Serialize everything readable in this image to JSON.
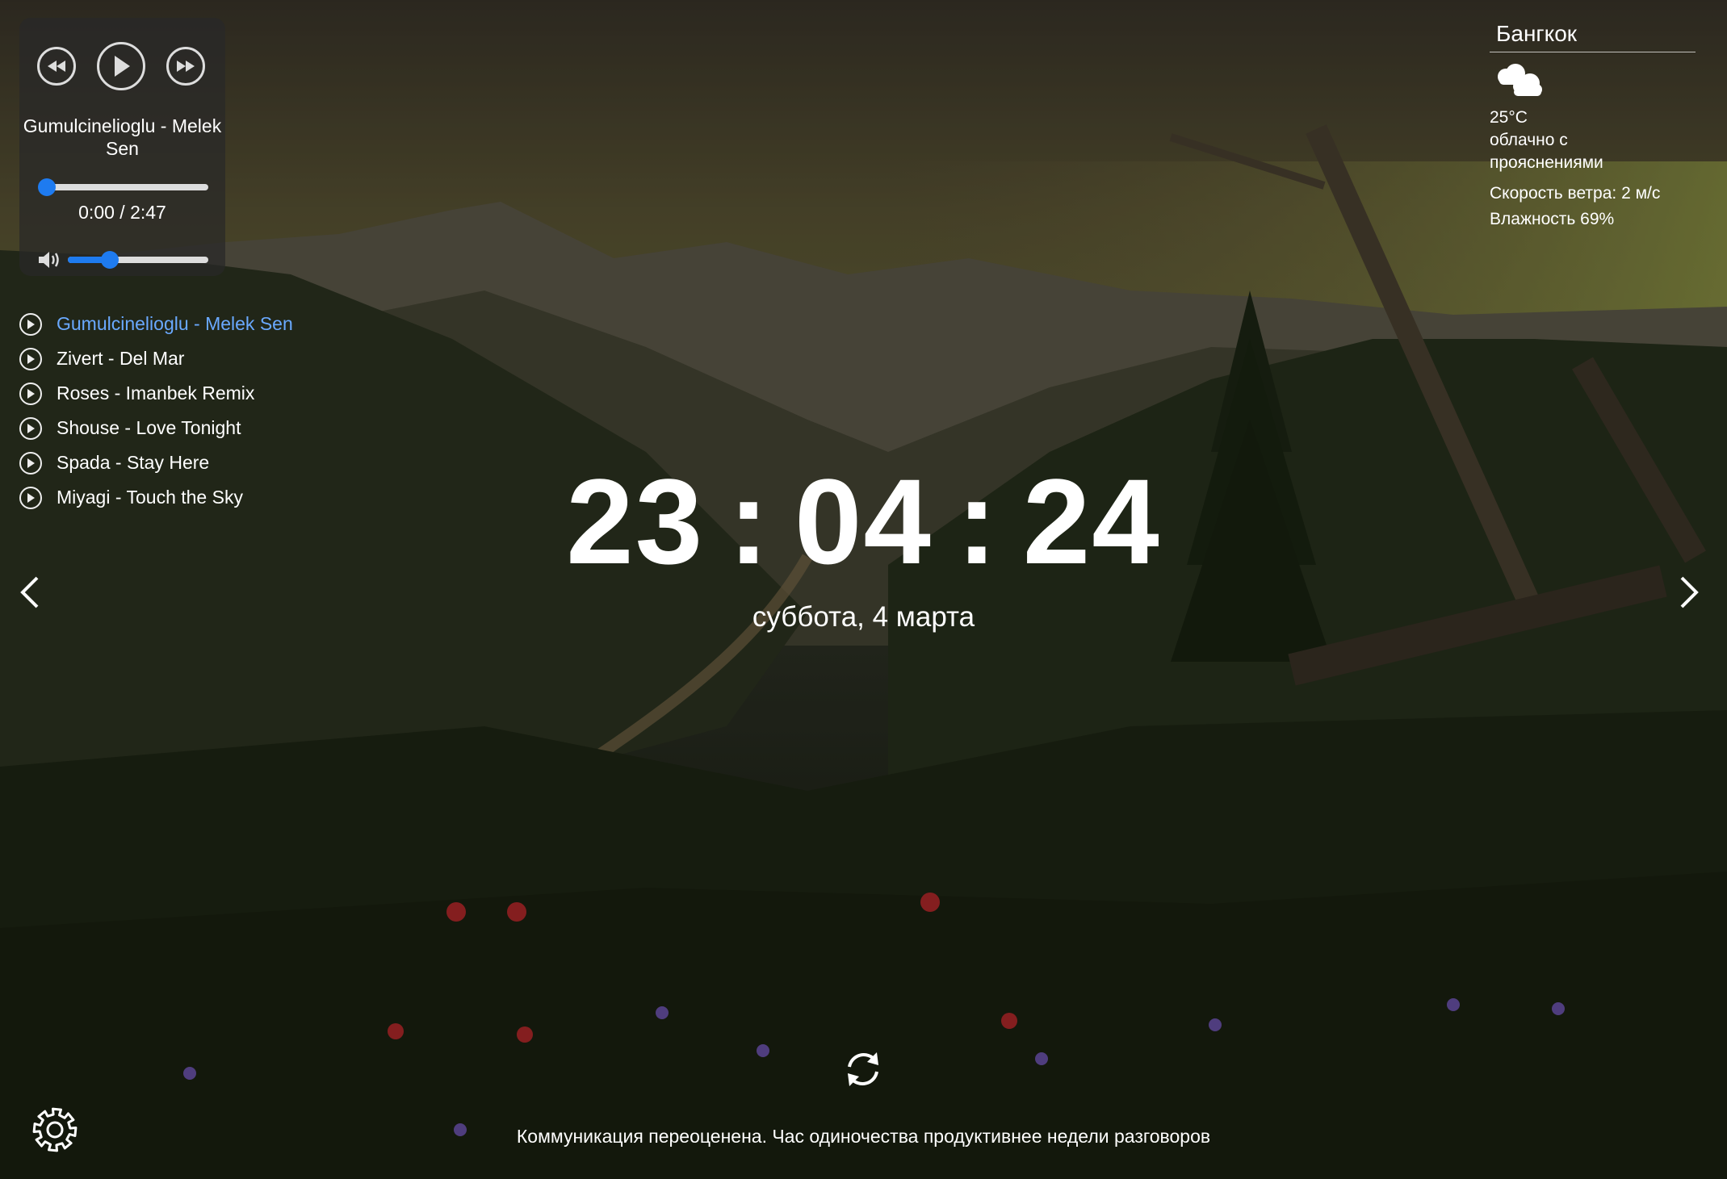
{
  "player": {
    "track_title": "Gumulcinelioglu - Melek Sen",
    "time": "0:00 / 2:47",
    "progress": 0.0,
    "volume": 0.3,
    "accent_color": "#1e7bf0"
  },
  "playlist": [
    {
      "label": "Gumulcinelioglu - Melek Sen",
      "active": true
    },
    {
      "label": "Zivert - Del Mar",
      "active": false
    },
    {
      "label": "Roses - Imanbek Remix",
      "active": false
    },
    {
      "label": "Shouse - Love Tonight",
      "active": false
    },
    {
      "label": "Spada - Stay Here",
      "active": false
    },
    {
      "label": "Miyagi - Touch the Sky",
      "active": false
    }
  ],
  "weather": {
    "city": "Бангкок",
    "icon": "cloud-icon",
    "temperature": "25°C",
    "description": "облачно с прояснениями",
    "wind": "Скорость ветра: 2 м/с",
    "humidity": "Влажность 69%"
  },
  "clock": {
    "hours": "23",
    "minutes": "04",
    "seconds": "24",
    "separator": ":",
    "date": "суббота, 4 марта"
  },
  "quote": "Коммуникация переоценена. Час одиночества продуктивнее недели разговоров",
  "icons": {
    "prev": "rewind-icon",
    "play": "play-icon",
    "next": "fast-forward-icon",
    "volume": "volume-icon",
    "slider_left": "chevron-left-icon",
    "slider_right": "chevron-right-icon",
    "refresh": "refresh-icon",
    "settings": "gear-icon"
  }
}
